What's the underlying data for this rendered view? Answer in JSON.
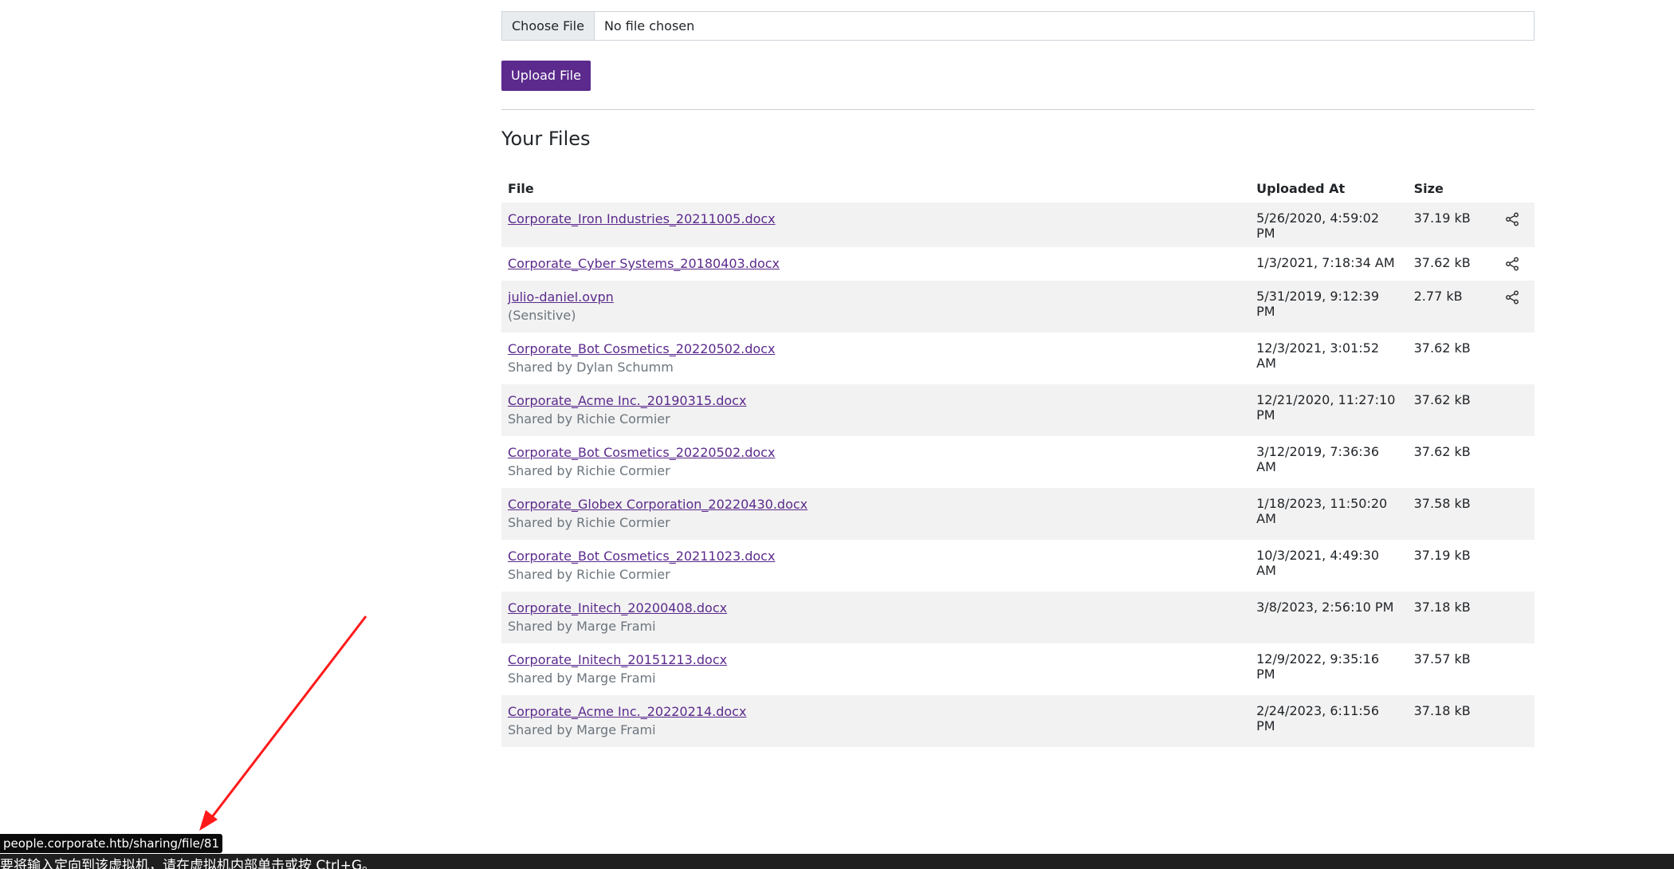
{
  "upload": {
    "choose_label": "Choose File",
    "chosen_text": "No file chosen",
    "button_label": "Upload File"
  },
  "section_title": "Your Files",
  "table": {
    "headers": {
      "file": "File",
      "uploaded": "Uploaded At",
      "size": "Size"
    },
    "rows": [
      {
        "name": "Corporate_Iron Industries_20211005.docx",
        "sub": "",
        "date": "5/26/2020, 4:59:02 PM",
        "size": "37.19 kB",
        "share": true
      },
      {
        "name": "Corporate_Cyber Systems_20180403.docx",
        "sub": "",
        "date": "1/3/2021, 7:18:34 AM",
        "size": "37.62 kB",
        "share": true
      },
      {
        "name": "julio-daniel.ovpn",
        "sub": "(Sensitive)",
        "date": "5/31/2019, 9:12:39 PM",
        "size": "2.77 kB",
        "share": true
      },
      {
        "name": "Corporate_Bot Cosmetics_20220502.docx",
        "sub": "Shared by Dylan Schumm",
        "date": "12/3/2021, 3:01:52 AM",
        "size": "37.62 kB",
        "share": false
      },
      {
        "name": "Corporate_Acme Inc._20190315.docx",
        "sub": "Shared by Richie Cormier",
        "date": "12/21/2020, 11:27:10 PM",
        "size": "37.62 kB",
        "share": false
      },
      {
        "name": "Corporate_Bot Cosmetics_20220502.docx",
        "sub": "Shared by Richie Cormier",
        "date": "3/12/2019, 7:36:36 AM",
        "size": "37.62 kB",
        "share": false
      },
      {
        "name": "Corporate_Globex Corporation_20220430.docx",
        "sub": "Shared by Richie Cormier",
        "date": "1/18/2023, 11:50:20 AM",
        "size": "37.58 kB",
        "share": false
      },
      {
        "name": "Corporate_Bot Cosmetics_20211023.docx",
        "sub": "Shared by Richie Cormier",
        "date": "10/3/2021, 4:49:30 AM",
        "size": "37.19 kB",
        "share": false
      },
      {
        "name": "Corporate_Initech_20200408.docx",
        "sub": "Shared by Marge Frami",
        "date": "3/8/2023, 2:56:10 PM",
        "size": "37.18 kB",
        "share": false
      },
      {
        "name": "Corporate_Initech_20151213.docx",
        "sub": "Shared by Marge Frami",
        "date": "12/9/2022, 9:35:16 PM",
        "size": "37.57 kB",
        "share": false
      },
      {
        "name": "Corporate_Acme Inc._20220214.docx",
        "sub": "Shared by Marge Frami",
        "date": "2/24/2023, 6:11:56 PM",
        "size": "37.18 kB",
        "share": false
      }
    ]
  },
  "status_url": "people.corporate.htb/sharing/file/81",
  "vm_bar_text": "要将输入定向到该虚拟机，请在虚拟机内部单击或按 Ctrl+G。",
  "colors": {
    "accent": "#5b2a8c",
    "row_stripe": "#f2f2f2",
    "arrow": "#ff1a1a"
  },
  "icons": {
    "share": "share-icon"
  }
}
